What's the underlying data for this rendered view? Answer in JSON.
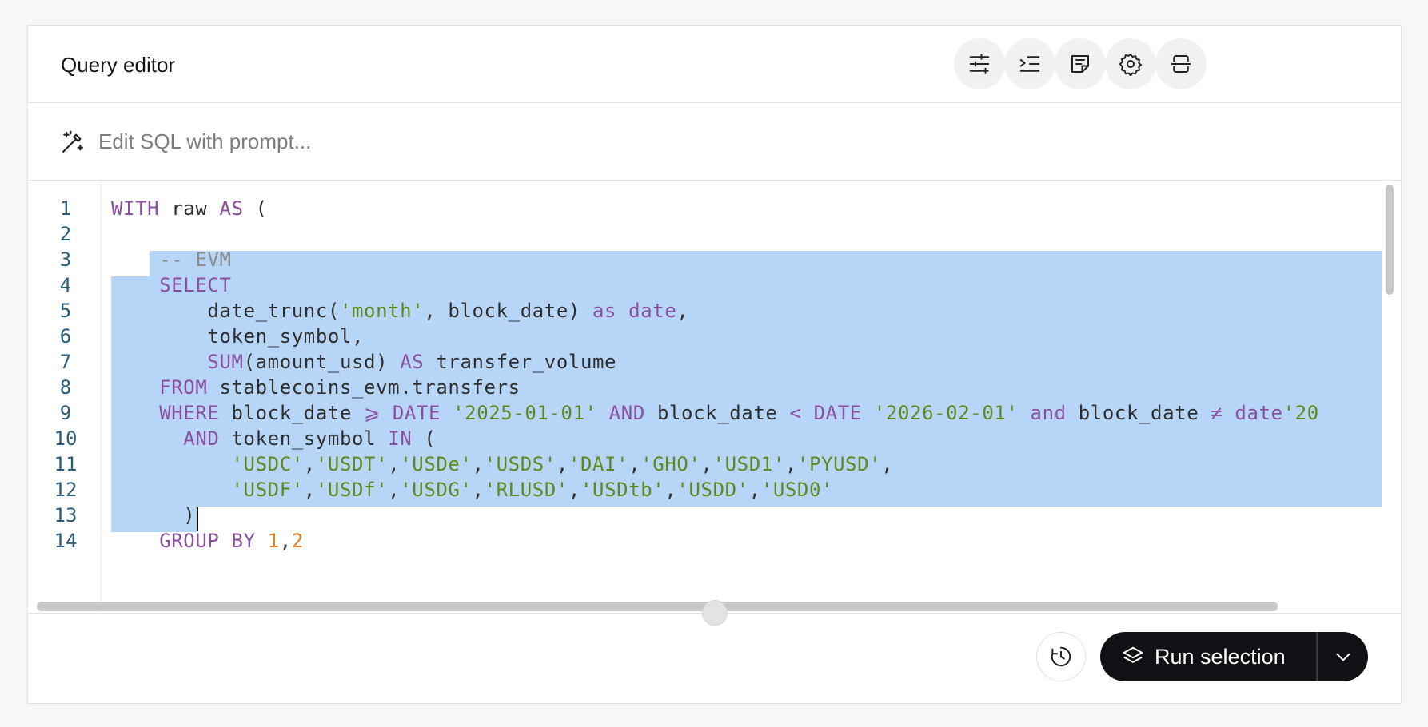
{
  "header": {
    "title": "Query editor",
    "buttons": [
      {
        "name": "params-icon"
      },
      {
        "name": "indent-icon"
      },
      {
        "name": "note-icon"
      },
      {
        "name": "gear-icon"
      },
      {
        "name": "collapse-icon"
      }
    ]
  },
  "prompt": {
    "placeholder": "Edit SQL with prompt..."
  },
  "editor": {
    "line_numbers": [
      "1",
      "2",
      "3",
      "4",
      "5",
      "6",
      "7",
      "8",
      "9",
      "10",
      "11",
      "12",
      "13",
      "14"
    ],
    "lines": [
      "WITH raw AS (",
      "",
      "    -- EVM",
      "    SELECT",
      "        date_trunc('month', block_date) as date,",
      "        token_symbol,",
      "        SUM(amount_usd) AS transfer_volume",
      "    FROM stablecoins_evm.transfers",
      "    WHERE block_date ⩾ DATE '2025-01-01' AND block_date < DATE '2026-02-01' and block_date ≠ date'20",
      "      AND token_symbol IN (",
      "          'USDC','USDT','USDe','USDS','DAI','GHO','USD1','PYUSD',",
      "          'USDF','USDf','USDG','RLUSD','USDtb','USDD','USD0'",
      "      )",
      "    GROUP BY 1,2"
    ],
    "selected_lines": "3-13"
  },
  "footer": {
    "run_label": "Run selection",
    "history_icon": "history-icon",
    "run_icon": "layers-icon",
    "dropdown_icon": "chevron-down-icon"
  },
  "colors": {
    "keyword": "#8a4fa1",
    "string": "#5f8a1b",
    "number": "#e17a1c",
    "comment": "#8b8b8b",
    "selection": "#b7d5f7",
    "run_button": "#101114"
  }
}
